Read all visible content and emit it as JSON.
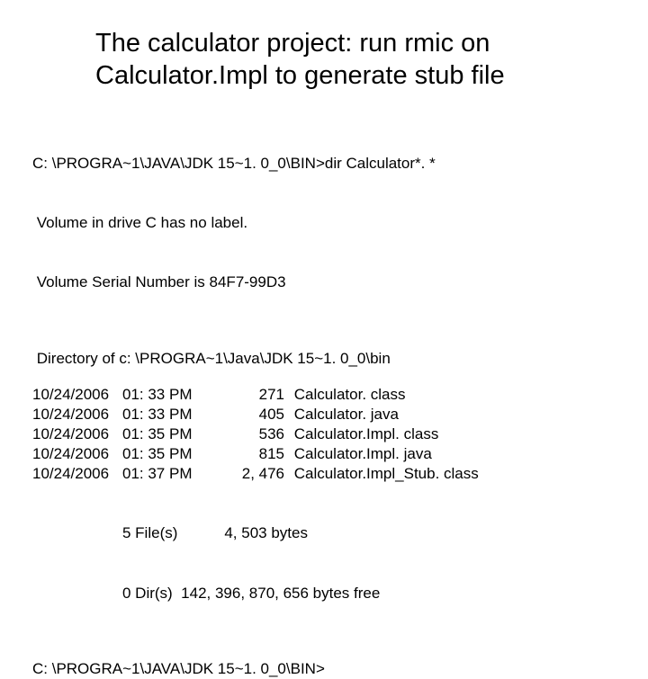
{
  "title": "The calculator project: run rmic on Calculator.Impl to generate stub file",
  "prompt_line": "C: \\PROGRA~1\\JAVA\\JDK 15~1. 0_0\\BIN>dir Calculator*. *",
  "vol1": " Volume in drive C has no label.",
  "vol2": " Volume Serial Number is 84F7-99D3",
  "dir_of": " Directory of c: \\PROGRA~1\\Java\\JDK 15~1. 0_0\\bin",
  "files": [
    {
      "date": "10/24/2006",
      "time": "01: 33 PM",
      "size": "271",
      "name": "Calculator. class"
    },
    {
      "date": "10/24/2006",
      "time": "01: 33 PM",
      "size": "405",
      "name": "Calculator. java"
    },
    {
      "date": "10/24/2006",
      "time": "01: 35 PM",
      "size": "536",
      "name": "Calculator.Impl. class"
    },
    {
      "date": "10/24/2006",
      "time": "01: 35 PM",
      "size": "815",
      "name": "Calculator.Impl. java"
    },
    {
      "date": "10/24/2006",
      "time": "01: 37 PM",
      "size": "2, 476",
      "name": "Calculator.Impl_Stub. class"
    }
  ],
  "summary1": "5 File(s)           4, 503 bytes",
  "summary2": "0 Dir(s)  142, 396, 870, 656 bytes free",
  "prompt_end": "C: \\PROGRA~1\\JAVA\\JDK 15~1. 0_0\\BIN>"
}
